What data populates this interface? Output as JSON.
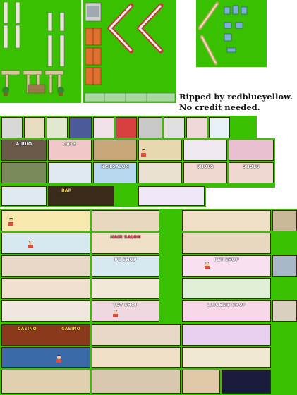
{
  "credit": {
    "line1": "Ripped by redblueyellow.",
    "line2": "No credit needed."
  },
  "signs": {
    "audio": "AUDIO",
    "cake": "CAKE",
    "nail_salon": "NAILSALON",
    "shoes_1": "SHOES",
    "shoes_2": "SHOES",
    "bar": "BAR",
    "hair_salon": "HAIR SALON",
    "pc_shop": "PC SHOP",
    "pet_shop": "PET SHOP",
    "toy_shop": "TOY SHOP",
    "lingerie_shop": "LINGERIE SHOP",
    "casino_1": "CASINO",
    "casino_2": "CASINO"
  },
  "colors": {
    "background_key": "#39c000",
    "sheet_bg": "#ffffff",
    "credit_text": "#111111"
  }
}
